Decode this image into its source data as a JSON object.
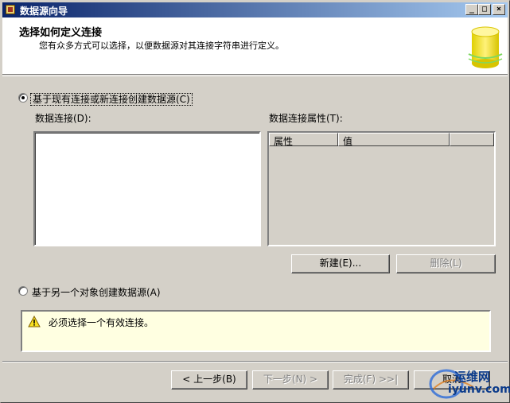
{
  "window": {
    "title": "数据源向导",
    "controls": {
      "minimize": "_",
      "maximize": "□",
      "close": "×"
    }
  },
  "header": {
    "title": "选择如何定义连接",
    "subtitle": "您有众多方式可以选择，以便数据源对其连接字符串进行定义。",
    "art_icon": "database-cylinder-icon"
  },
  "option_existing": {
    "label": "基于现有连接或新连接创建数据源(C)",
    "checked": true
  },
  "data_connections": {
    "label": "数据连接(D):",
    "items": []
  },
  "connection_properties": {
    "label": "数据连接属性(T):",
    "columns": [
      "属性",
      "值",
      ""
    ]
  },
  "buttons": {
    "new": "新建(E)...",
    "delete": "删除(L)",
    "back": "< 上一步(B)",
    "next": "下一步(N) >",
    "finish": "完成(F) >>|",
    "cancel": "取消"
  },
  "option_other_object": {
    "label": "基于另一个对象创建数据源(A)",
    "checked": false
  },
  "warning": {
    "icon": "warning-triangle-icon",
    "text": "必须选择一个有效连接。"
  },
  "watermark": {
    "line1": "运维网",
    "line2": "iyunv.com"
  },
  "colors": {
    "face": "#d4d0c8",
    "title_start": "#0a246a",
    "title_end": "#a6caf0",
    "info_bg": "#ffffe1"
  }
}
